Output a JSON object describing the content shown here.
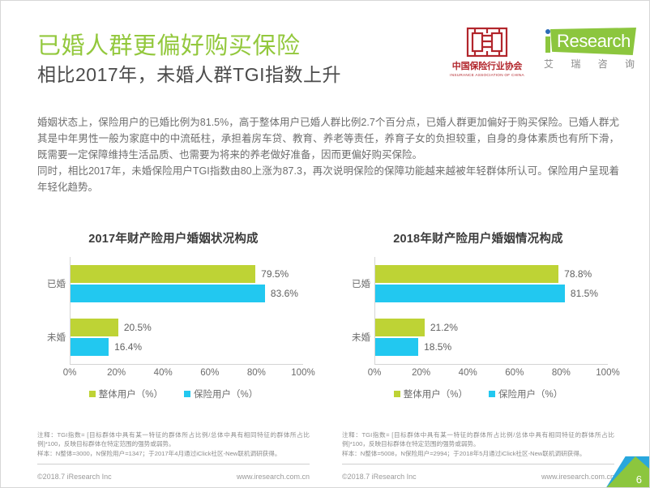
{
  "header": {
    "main_title": "已婚人群更偏好购买保险",
    "sub_title": "相比2017年，未婚人群TGI指数上升",
    "title_color": "#93c83d",
    "logos": {
      "iac": {
        "name_cn": "中国保险行业协会",
        "name_en": "INSURANCE ASSOCIATION OF CHINA",
        "color": "#b2262c"
      },
      "iresearch": {
        "wordmark": "Research",
        "initial": "i",
        "name_cn_1": "艾",
        "name_cn_2": "瑞",
        "name_cn_3": "咨",
        "name_cn_4": "询",
        "color": "#8cc63e"
      }
    }
  },
  "body": {
    "paragraph_1": "婚姻状态上，保险用户的已婚比例为81.5%，高于整体用户已婚人群比例2.7个百分点，已婚人群更加偏好于购买保险。已婚人群尤其是中年男性一般为家庭中的中流砥柱，承担着房车贷、教育、养老等责任，养育子女的负担较重，自身的身体素质也有所下滑，既需要一定保障维持生活品质、也需要为将来的养老做好准备，因而更偏好购买保险。",
    "paragraph_2": "同时，相比2017年，未婚保险用户TGI指数由80上涨为87.3，再次说明保险的保障功能越来越被年轻群体所认可。保险用户呈现着年轻化趋势。"
  },
  "chart_data": [
    {
      "type": "bar",
      "orientation": "horizontal",
      "title": "2017年财产险用户婚姻状况构成",
      "categories": [
        "已婚",
        "未婚"
      ],
      "series": [
        {
          "name": "整体用户（%）",
          "color": "#bed335",
          "values": [
            79.5,
            20.5
          ],
          "labels": [
            "79.5%",
            "20.5%"
          ]
        },
        {
          "name": "保险用户（%）",
          "color": "#22c8f0",
          "values": [
            83.6,
            16.4
          ],
          "labels": [
            "83.6%",
            "16.4%"
          ]
        }
      ],
      "xlim": [
        0,
        100
      ],
      "xticks": [
        0,
        20,
        40,
        60,
        80,
        100
      ],
      "xtick_labels": [
        "0%",
        "20%",
        "40%",
        "60%",
        "80%",
        "100%"
      ],
      "xlabel": "",
      "ylabel": "",
      "grid": false,
      "legend_position": "bottom",
      "footnote_1": "注释：TGI指数= [目标群体中具有某一特征的群体所占比例/总体中具有相同特征的群体所占比例]*100，反映目标群体在特定范围的强势或弱势。",
      "footnote_2": "样本：N整体=3000，N保险用户=1347；于2017年4月通过iClick社区-New联机调研获得。"
    },
    {
      "type": "bar",
      "orientation": "horizontal",
      "title": "2018年财产险用户婚姻情况构成",
      "categories": [
        "已婚",
        "未婚"
      ],
      "series": [
        {
          "name": "整体用户（%）",
          "color": "#bed335",
          "values": [
            78.8,
            21.2
          ],
          "labels": [
            "78.8%",
            "21.2%"
          ]
        },
        {
          "name": "保险用户（%）",
          "color": "#22c8f0",
          "values": [
            81.5,
            18.5
          ],
          "labels": [
            "81.5%",
            "18.5%"
          ]
        }
      ],
      "xlim": [
        0,
        100
      ],
      "xticks": [
        0,
        20,
        40,
        60,
        80,
        100
      ],
      "xtick_labels": [
        "0%",
        "20%",
        "40%",
        "60%",
        "80%",
        "100%"
      ],
      "xlabel": "",
      "ylabel": "",
      "grid": false,
      "legend_position": "bottom",
      "footnote_1": "注释：TGI指数= [目标群体中具有某一特征的群体所占比例/总体中具有相同特征的群体所占比例]*100，反映目标群体在特定范围的强势或弱势。",
      "footnote_2": "样本：N整体=5008，N保险用户=2994；于2018年5月通过iClick社区-New联机调研获得。"
    }
  ],
  "footer": {
    "copyright": "©2018.7 iResearch Inc",
    "website": "www.iresearch.com.cn",
    "page_number": "6"
  }
}
